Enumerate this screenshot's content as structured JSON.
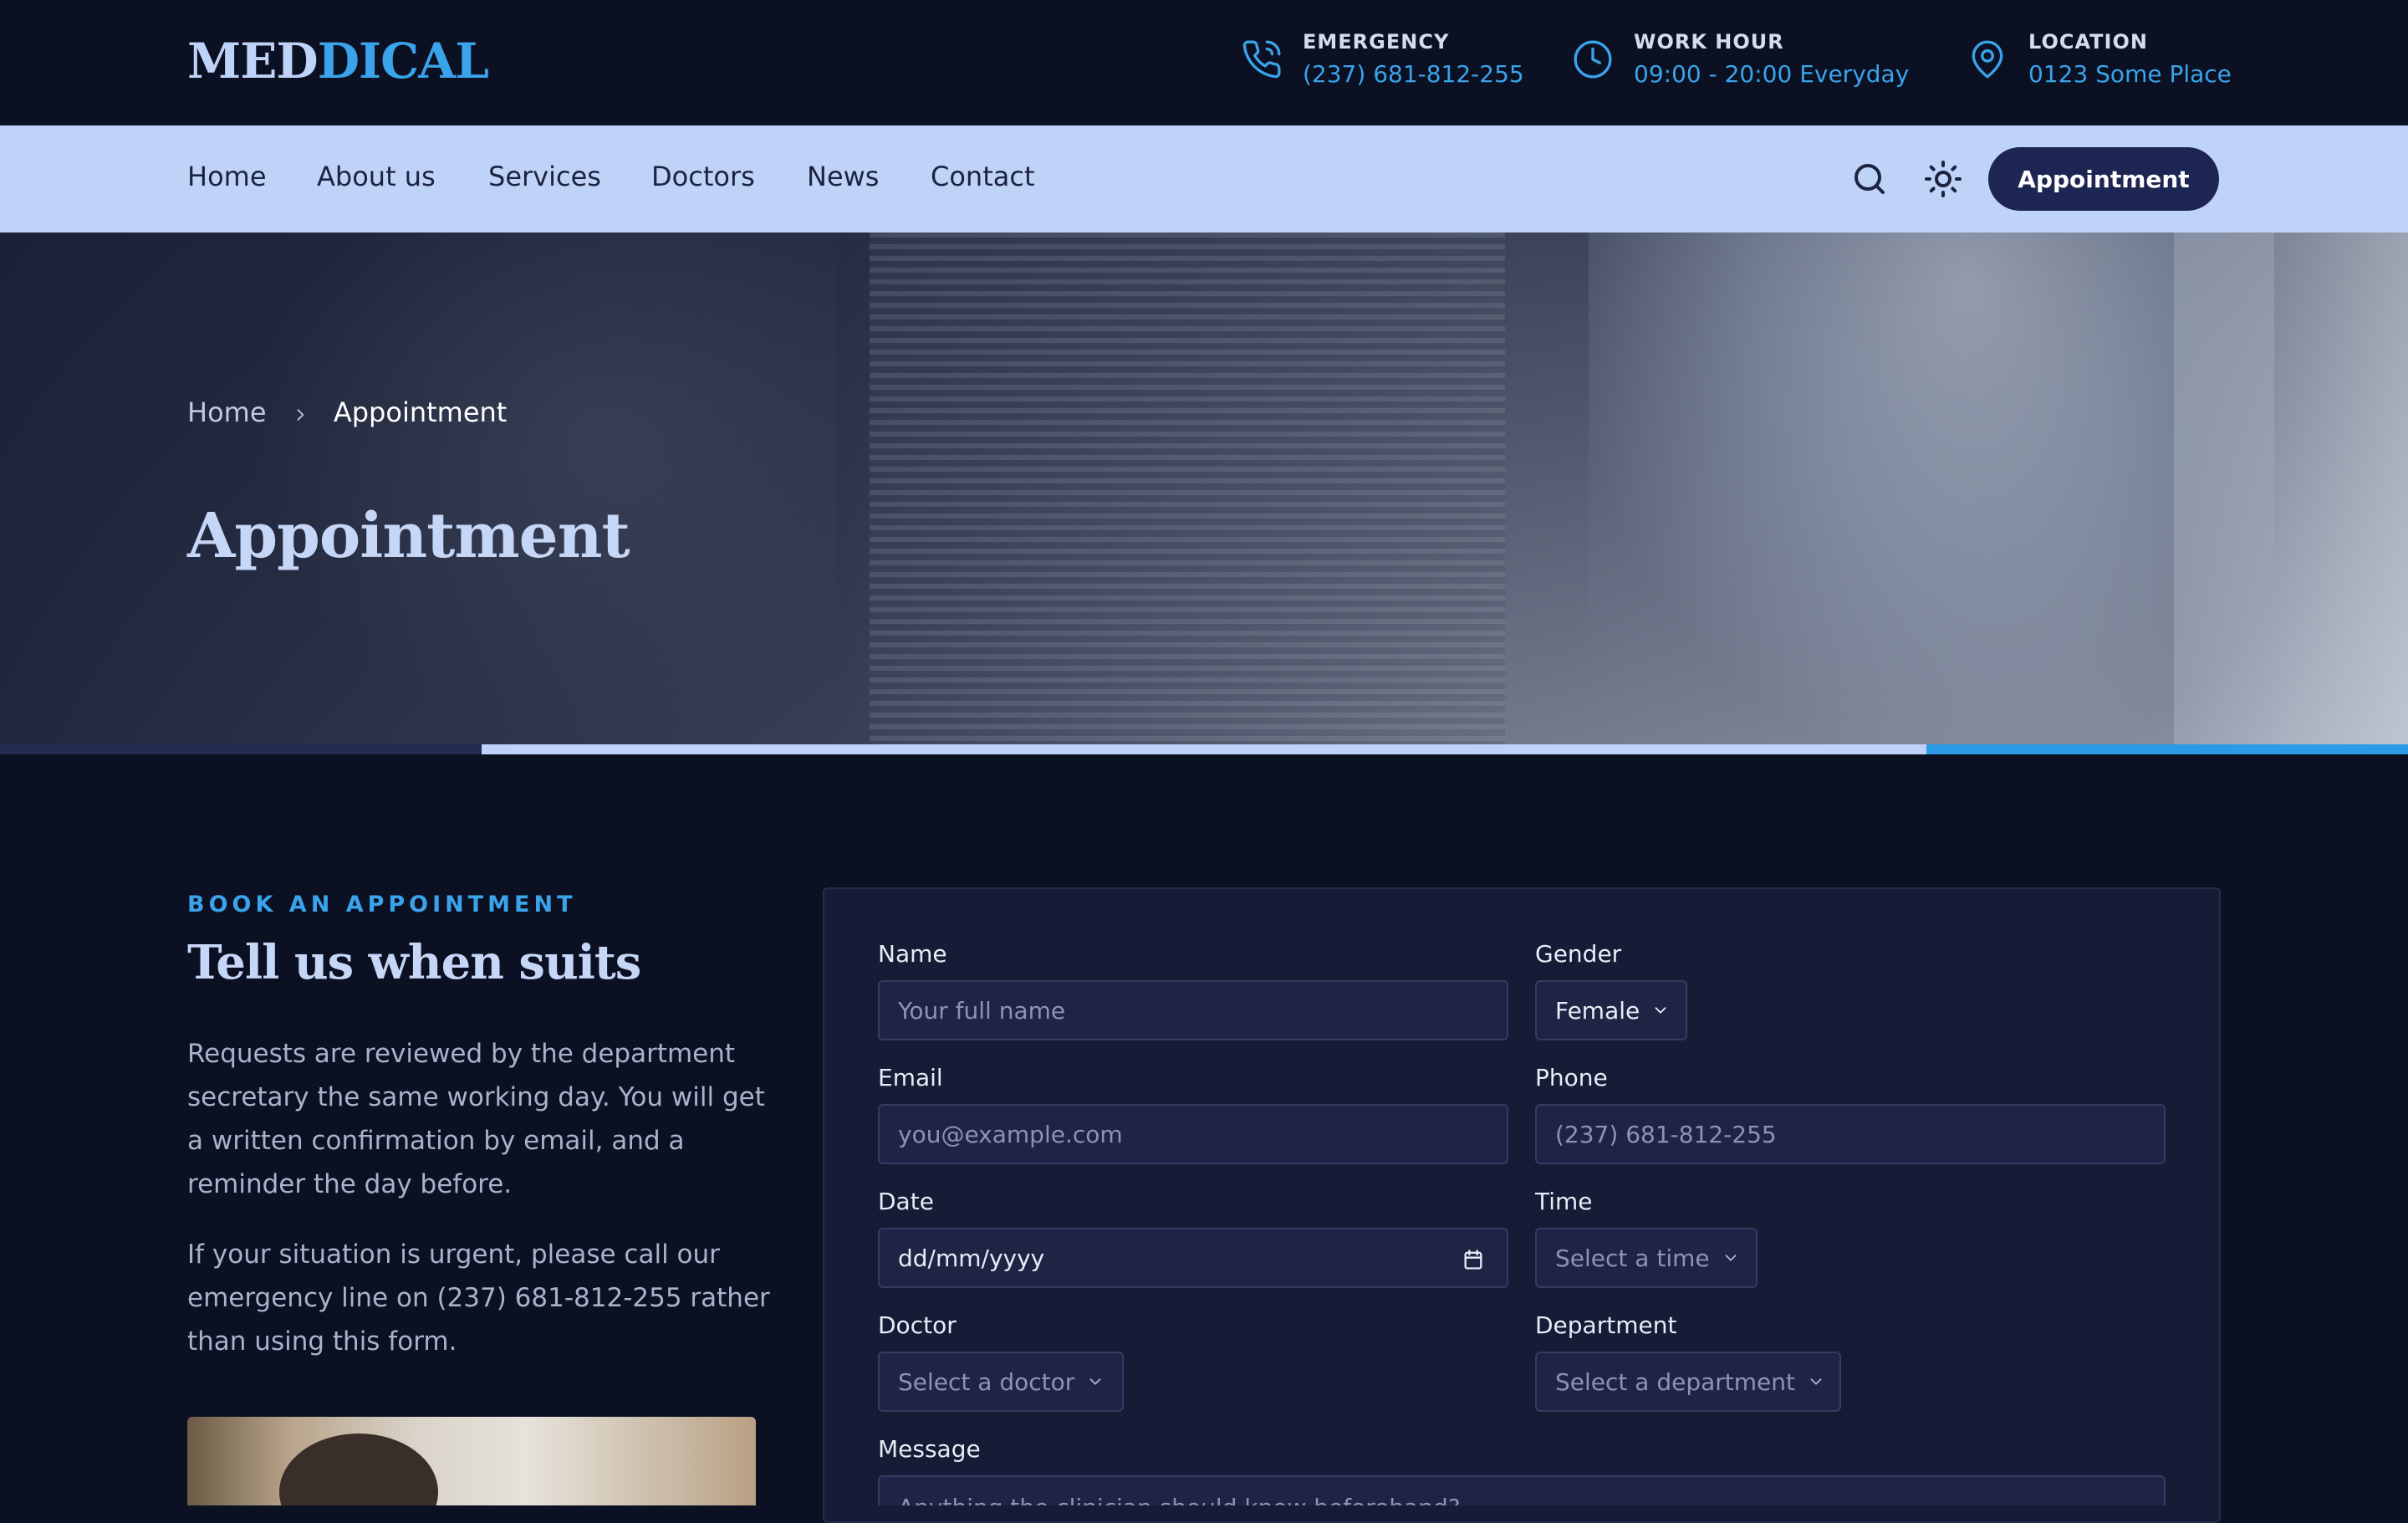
{
  "logo": {
    "part1": "MED",
    "part2": "DICAL"
  },
  "topbar": {
    "emergency": {
      "label": "EMERGENCY",
      "value": "(237) 681-812-255",
      "icon": "phone-icon"
    },
    "work_hour": {
      "label": "WORK HOUR",
      "value": "09:00 - 20:00 Everyday",
      "icon": "clock-icon"
    },
    "location": {
      "label": "LOCATION",
      "value": "0123 Some Place",
      "icon": "map-pin-icon"
    }
  },
  "nav": {
    "links": [
      "Home",
      "About us",
      "Services",
      "Doctors",
      "News",
      "Contact"
    ],
    "search_icon": "search-icon",
    "theme_icon": "sun-icon",
    "appointment_button": "Appointment"
  },
  "hero": {
    "breadcrumb": {
      "home": "Home",
      "current": "Appointment"
    },
    "title": "Appointment"
  },
  "intro": {
    "eyebrow": "BOOK AN APPOINTMENT",
    "heading": "Tell us when suits",
    "para1": "Requests are reviewed by the department secretary the same working day. You will get a written confirmation by email, and a reminder the day before.",
    "para2": "If your situation is urgent, please call our emergency line on (237) 681-812-255 rather than using this form."
  },
  "form": {
    "name": {
      "label": "Name",
      "placeholder": "Your full name"
    },
    "gender": {
      "label": "Gender",
      "value": "Female"
    },
    "email": {
      "label": "Email",
      "placeholder": "you@example.com"
    },
    "phone": {
      "label": "Phone",
      "placeholder": "(237) 681-812-255"
    },
    "date": {
      "label": "Date",
      "value": "dd/mm/yyyy"
    },
    "time": {
      "label": "Time",
      "value": "Select a time"
    },
    "doctor": {
      "label": "Doctor",
      "value": "Select a doctor"
    },
    "department": {
      "label": "Department",
      "value": "Select a department"
    },
    "message": {
      "label": "Message",
      "placeholder": "Anything the clinician should know beforehand?"
    }
  },
  "colors": {
    "background": "#0b1023",
    "nav_background": "#bfd3f8",
    "accent": "#3aa3ea",
    "button": "#1d2652",
    "card": "#161b36"
  }
}
